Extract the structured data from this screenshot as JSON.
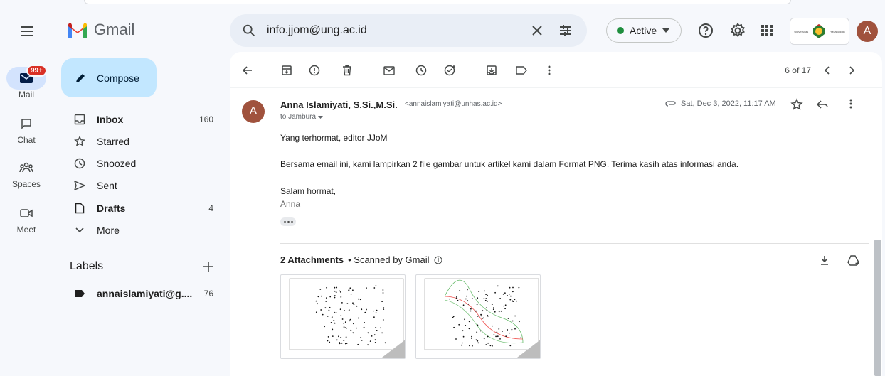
{
  "app": {
    "title": "Gmail"
  },
  "search": {
    "value": "info.jjom@ung.ac.id"
  },
  "status": {
    "label": "Active",
    "color": "#1e8e3e"
  },
  "org_logo": {
    "text_left": "Universitas",
    "text_right": "Hasanuddin"
  },
  "account": {
    "initial": "A",
    "color": "#a0523d"
  },
  "rail": [
    {
      "label": "Mail",
      "badge": "99+"
    },
    {
      "label": "Chat"
    },
    {
      "label": "Spaces"
    },
    {
      "label": "Meet"
    }
  ],
  "compose": {
    "label": "Compose"
  },
  "nav": [
    {
      "label": "Inbox",
      "count": "160",
      "icon": "inbox-icon"
    },
    {
      "label": "Starred",
      "count": "",
      "icon": "star-icon"
    },
    {
      "label": "Snoozed",
      "count": "",
      "icon": "clock-icon"
    },
    {
      "label": "Sent",
      "count": "",
      "icon": "send-icon"
    },
    {
      "label": "Drafts",
      "count": "4",
      "icon": "draft-icon"
    },
    {
      "label": "More",
      "count": "",
      "icon": "chevron-down-icon"
    }
  ],
  "labels": {
    "title": "Labels",
    "items": [
      {
        "label": "annaislamiyati@g....",
        "count": "76"
      }
    ]
  },
  "toolbar": {
    "pager": "6 of 17"
  },
  "message": {
    "sender_initial": "A",
    "sender_name": "Anna Islamiyati, S.Si.,M.Si.",
    "sender_email": "<annaislamiyati@unhas.ac.id>",
    "recipient": "to Jambura",
    "date": "Sat, Dec 3, 2022, 11:17 AM",
    "greeting": "Yang terhormat, editor JJoM",
    "body": "Bersama email ini, kami lampirkan 2 file gambar untuk artikel kami dalam Format PNG. Terima kasih atas informasi anda.",
    "closing": "Salam hormat,",
    "closing_name": "Anna"
  },
  "attachments": {
    "title": "2 Attachments",
    "note": "• Scanned by Gmail"
  }
}
